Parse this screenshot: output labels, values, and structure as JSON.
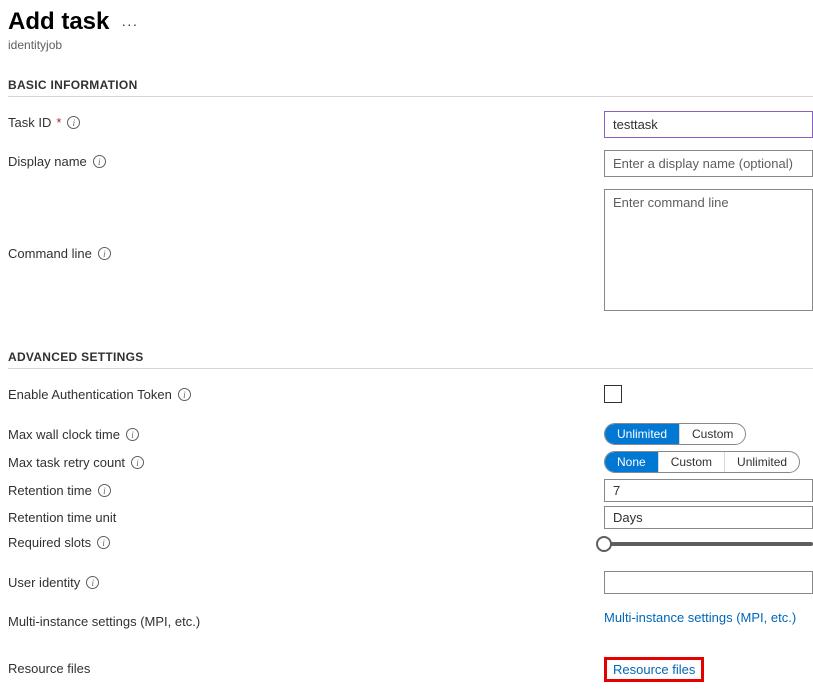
{
  "header": {
    "title": "Add task",
    "subtitle": "identityjob"
  },
  "sections": {
    "basic": "BASIC INFORMATION",
    "advanced": "ADVANCED SETTINGS"
  },
  "fields": {
    "task_id": {
      "label": "Task ID",
      "value": "testtask"
    },
    "display_name": {
      "label": "Display name",
      "placeholder": "Enter a display name (optional)"
    },
    "command_line": {
      "label": "Command line",
      "placeholder": "Enter command line"
    },
    "enable_auth": {
      "label": "Enable Authentication Token"
    },
    "max_wall": {
      "label": "Max wall clock time",
      "options": [
        "Unlimited",
        "Custom"
      ],
      "selected": "Unlimited"
    },
    "max_retry": {
      "label": "Max task retry count",
      "options": [
        "None",
        "Custom",
        "Unlimited"
      ],
      "selected": "None"
    },
    "retention_time": {
      "label": "Retention time",
      "value": "7"
    },
    "retention_unit": {
      "label": "Retention time unit",
      "value": "Days"
    },
    "required_slots": {
      "label": "Required slots"
    },
    "user_identity": {
      "label": "User identity",
      "value": ""
    },
    "multi_instance": {
      "label": "Multi-instance settings (MPI, etc.)",
      "link": "Multi-instance settings (MPI, etc.)"
    },
    "resource_files": {
      "label": "Resource files",
      "link": "Resource files"
    }
  }
}
